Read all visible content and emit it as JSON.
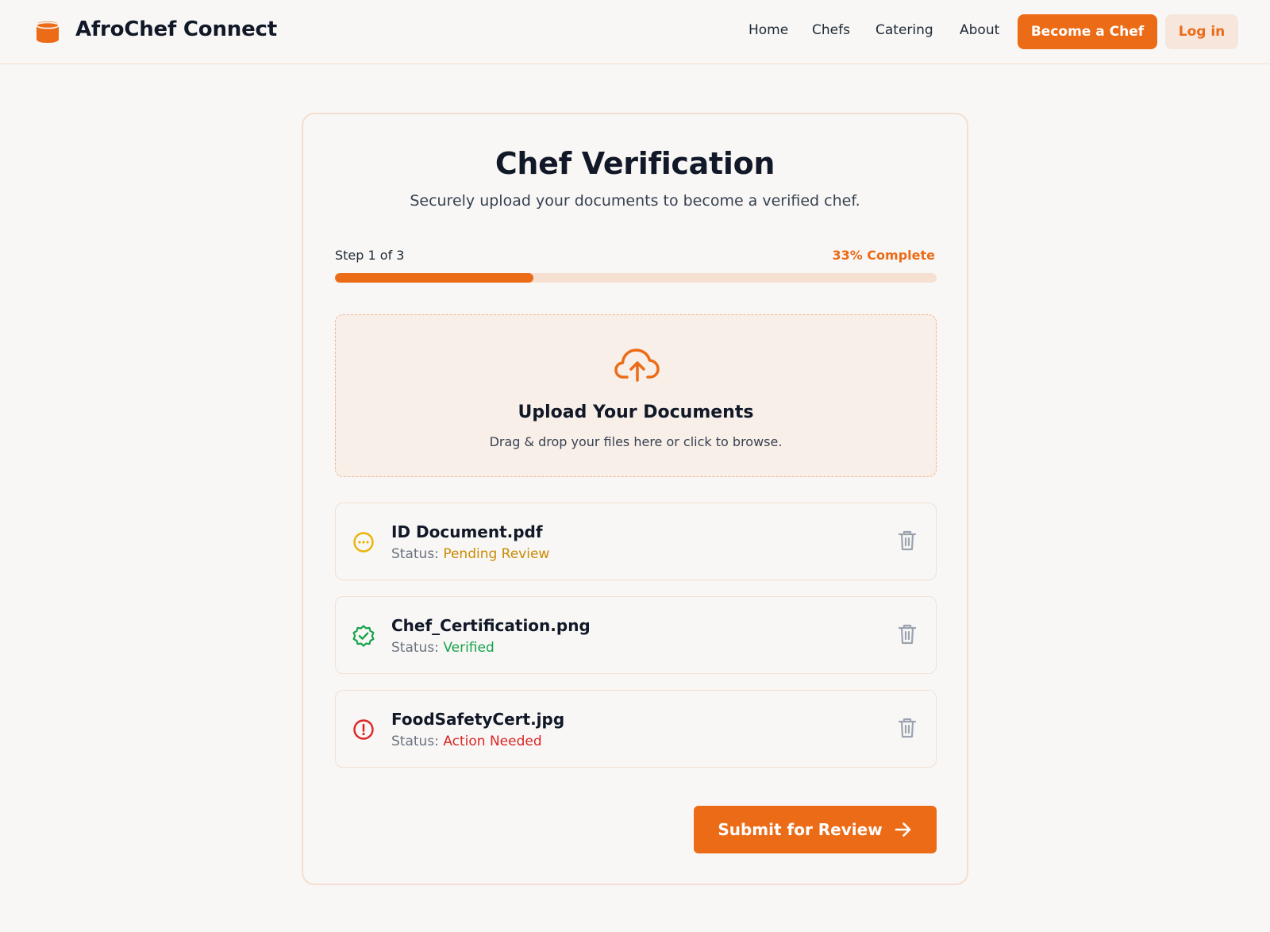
{
  "header": {
    "brand": "AfroChef Connect",
    "nav": [
      "Home",
      "Chefs",
      "Catering",
      "About"
    ],
    "become_chef": "Become a Chef",
    "login": "Log in"
  },
  "card": {
    "title": "Chef Verification",
    "subtitle": "Securely upload your documents to become a verified chef.",
    "step_label": "Step 1 of 3",
    "percent_label": "33% Complete",
    "progress": 0.33,
    "dropzone": {
      "title": "Upload Your Documents",
      "subtitle": "Drag & drop your files here or click to browse."
    },
    "status_prefix": "Status:",
    "files": [
      {
        "name": "ID Document.pdf",
        "status": "Pending Review",
        "status_color": "#ca8a04",
        "icon": "pending-icon"
      },
      {
        "name": "Chef_Certification.png",
        "status": "Verified",
        "status_color": "#16a34a",
        "icon": "verified-badge-icon"
      },
      {
        "name": "FoodSafetyCert.jpg",
        "status": "Action Needed",
        "status_color": "#dc2626",
        "icon": "alert-circle-icon"
      }
    ],
    "submit_label": "Submit for Review"
  },
  "colors": {
    "accent": "#ec6b17",
    "background": "#f8f7f5"
  }
}
